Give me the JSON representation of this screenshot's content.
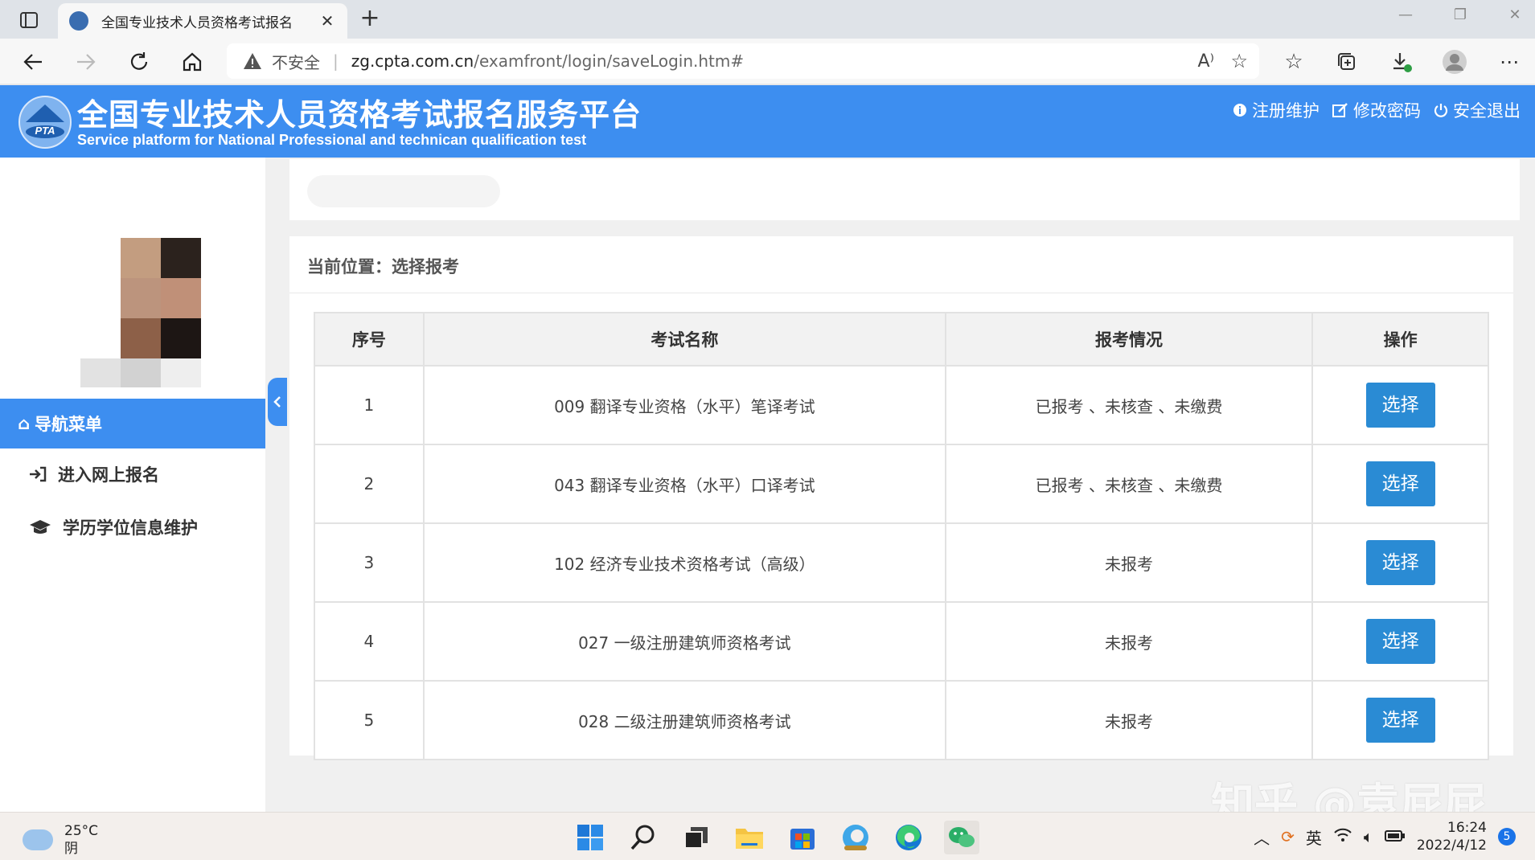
{
  "browser": {
    "tab_title": "全国专业技术人员资格考试报名",
    "address_warning": "不安全",
    "url_host": "zg.cpta.com.cn",
    "url_path": "/examfront/login/saveLogin.htm#"
  },
  "header": {
    "title": "全国专业技术人员资格考试报名服务平台",
    "subtitle": "Service platform for National Professional and technican qualification test",
    "logo_text": "PTA",
    "links": {
      "register_maintain": "注册维护",
      "change_password": "修改密码",
      "logout": "安全退出"
    },
    "color": "#3d8ef0"
  },
  "sidebar": {
    "nav_title": "导航菜单",
    "items": [
      {
        "label": "进入网上报名",
        "icon": "sign-in-icon"
      },
      {
        "label": "学历学位信息维护",
        "icon": "graduation-cap-icon"
      }
    ]
  },
  "main": {
    "breadcrumb": "当前位置：选择报考",
    "table": {
      "headers": [
        "序号",
        "考试名称",
        "报考情况",
        "操作"
      ],
      "rows": [
        {
          "no": "1",
          "name": "009 翻译专业资格（水平）笔译考试",
          "status": "已报考 、未核查 、未缴费",
          "action": "选择"
        },
        {
          "no": "2",
          "name": "043 翻译专业资格（水平）口译考试",
          "status": "已报考 、未核查 、未缴费",
          "action": "选择"
        },
        {
          "no": "3",
          "name": "102 经济专业技术资格考试（高级）",
          "status": "未报考",
          "action": "选择"
        },
        {
          "no": "4",
          "name": "027 一级注册建筑师资格考试",
          "status": "未报考",
          "action": "选择"
        },
        {
          "no": "5",
          "name": "028 二级注册建筑师资格考试",
          "status": "未报考",
          "action": "选择"
        }
      ]
    },
    "button_color": "#2a8bd4"
  },
  "watermark": "知乎 @袁屁屁",
  "taskbar": {
    "temperature": "25°C",
    "weather": "阴",
    "ime": "英",
    "time": "16:24",
    "date": "2022/4/12",
    "notifications": "5"
  }
}
